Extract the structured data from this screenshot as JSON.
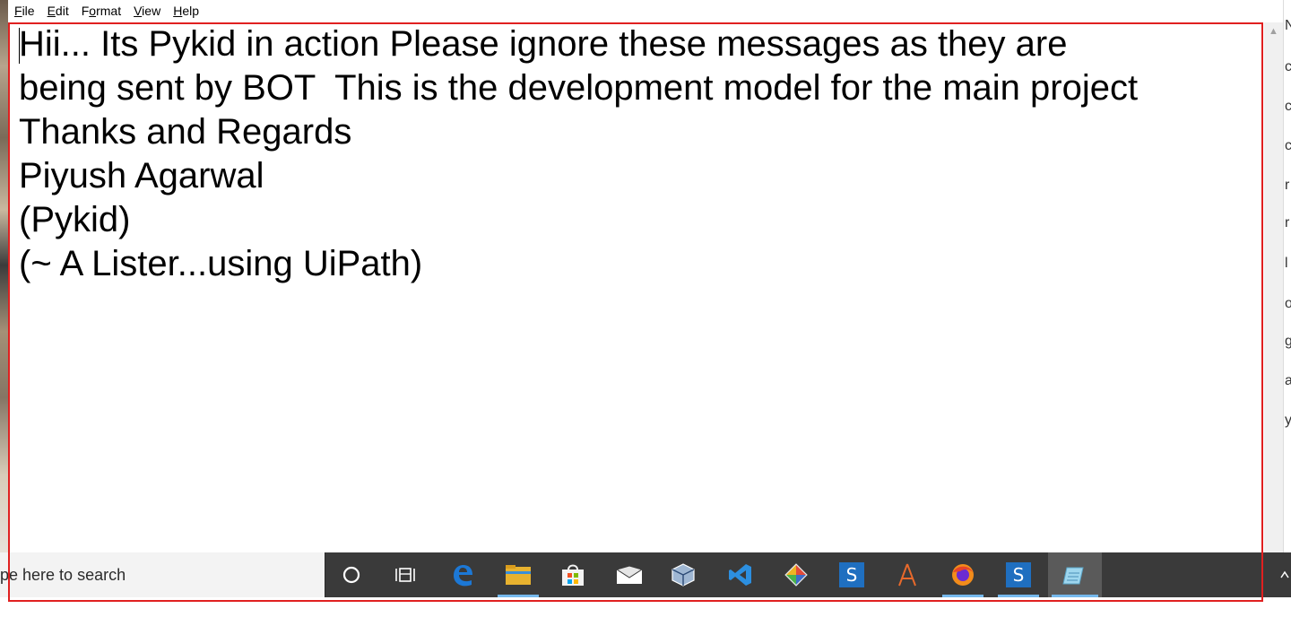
{
  "menubar": {
    "items": [
      {
        "underline": "F",
        "rest": "ile"
      },
      {
        "underline": "E",
        "rest": "dit"
      },
      {
        "underline": "o",
        "pre": "F",
        "rest": "rmat"
      },
      {
        "underline": "V",
        "rest": "iew"
      },
      {
        "underline": "H",
        "rest": "elp"
      }
    ],
    "labels": [
      "File",
      "Edit",
      "Format",
      "View",
      "Help"
    ]
  },
  "editor": {
    "lines": [
      "Hii... Its Pykid in action Please ignore these messages as they are",
      "being sent by BOT  This is the development model for the main project",
      "Thanks and Regards",
      "Piyush Agarwal",
      "(Pykid)",
      "(~ A Lister...using UiPath)"
    ]
  },
  "taskbar": {
    "search_placeholder": "pe here to search",
    "icons": [
      "cortana-icon",
      "task-view-icon",
      "edge-icon",
      "file-explorer-icon",
      "store-icon",
      "mail-icon",
      "virtualbox-icon",
      "vscode-icon",
      "git-icon",
      "app-s-icon",
      "acrobat-icon",
      "firefox-icon",
      "app-s-icon-2",
      "notepad-icon"
    ]
  },
  "colors": {
    "frame": "#e02020",
    "taskbar": "#3a3a3a",
    "accent": "#76b9ed"
  }
}
